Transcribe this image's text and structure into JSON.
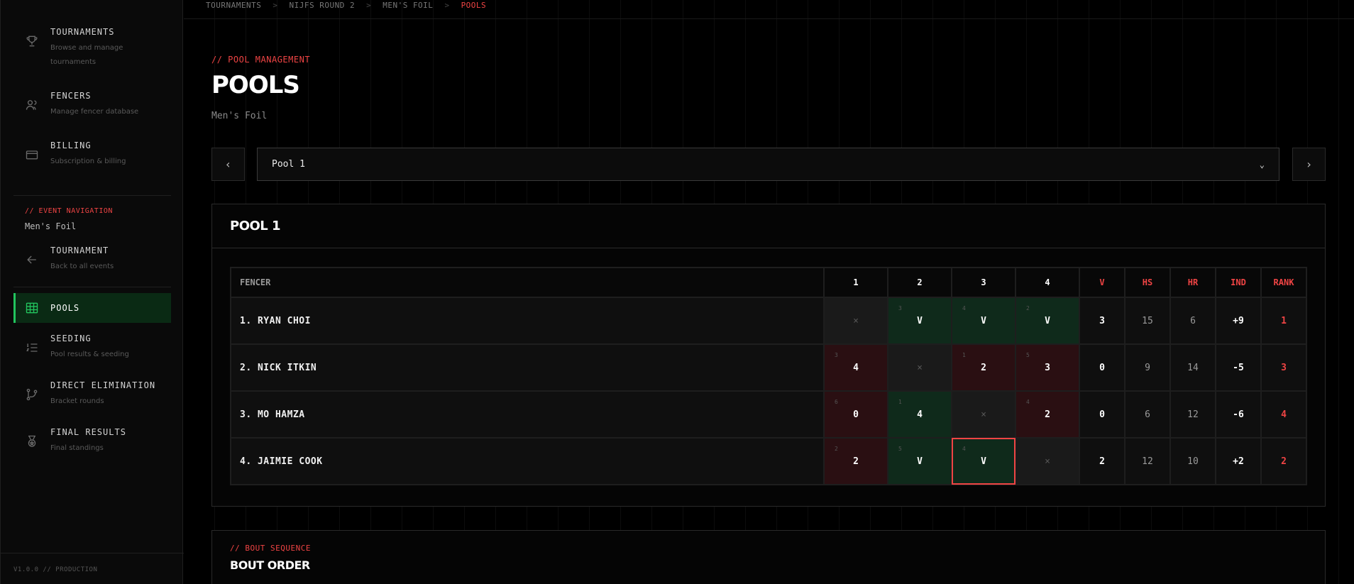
{
  "sidebar": {
    "items": [
      {
        "label": "TOURNAMENTS",
        "sub": "Browse and manage tournaments"
      },
      {
        "label": "FENCERS",
        "sub": "Manage fencer database"
      },
      {
        "label": "BILLING",
        "sub": "Subscription & billing"
      }
    ],
    "event_section": "// EVENT NAVIGATION",
    "event_name": "Men's Foil",
    "event_items": [
      {
        "label": "TOURNAMENT",
        "sub": "Back to all events"
      },
      {
        "label": "POOLS",
        "sub": ""
      },
      {
        "label": "SEEDING",
        "sub": "Pool results & seeding"
      },
      {
        "label": "DIRECT ELIMINATION",
        "sub": "Bracket rounds"
      },
      {
        "label": "FINAL RESULTS",
        "sub": "Final standings"
      }
    ],
    "version": "V1.0.0 // PRODUCTION"
  },
  "breadcrumb": [
    "TOURNAMENTS",
    "NIJFS ROUND 2",
    "MEN'S FOIL",
    "POOLS"
  ],
  "header": {
    "tag": "// POOL MANAGEMENT",
    "title": "POOLS",
    "subtitle": "Men's Foil"
  },
  "pool_select": {
    "value": "Pool 1"
  },
  "pool": {
    "title": "POOL 1",
    "headers": {
      "fencer": "FENCER",
      "cols": [
        "1",
        "2",
        "3",
        "4"
      ],
      "v": "V",
      "hs": "HS",
      "hr": "HR",
      "ind": "IND",
      "rank": "RANK"
    },
    "rows": [
      {
        "name": "1. RYAN CHOI",
        "bouts": [
          {
            "t": "self",
            "v": "×",
            "o": ""
          },
          {
            "t": "win",
            "v": "V",
            "o": "3"
          },
          {
            "t": "win",
            "v": "V",
            "o": "4"
          },
          {
            "t": "win",
            "v": "V",
            "o": "2"
          }
        ],
        "v": "3",
        "hs": "15",
        "hr": "6",
        "ind": "+9",
        "rank": "1"
      },
      {
        "name": "2. NICK ITKIN",
        "bouts": [
          {
            "t": "loss",
            "v": "4",
            "o": "3"
          },
          {
            "t": "self",
            "v": "×",
            "o": ""
          },
          {
            "t": "loss",
            "v": "2",
            "o": "1"
          },
          {
            "t": "loss",
            "v": "3",
            "o": "5"
          }
        ],
        "v": "0",
        "hs": "9",
        "hr": "14",
        "ind": "-5",
        "rank": "3"
      },
      {
        "name": "3. MO HAMZA",
        "bouts": [
          {
            "t": "loss",
            "v": "0",
            "o": "6"
          },
          {
            "t": "win",
            "v": "4",
            "o": "1"
          },
          {
            "t": "self",
            "v": "×",
            "o": ""
          },
          {
            "t": "loss",
            "v": "2",
            "o": "4"
          }
        ],
        "v": "0",
        "hs": "6",
        "hr": "12",
        "ind": "-6",
        "rank": "4"
      },
      {
        "name": "4. JAIMIE COOK",
        "bouts": [
          {
            "t": "loss",
            "v": "2",
            "o": "2"
          },
          {
            "t": "win",
            "v": "V",
            "o": "5"
          },
          {
            "t": "win sel",
            "v": "V",
            "o": "4"
          },
          {
            "t": "self",
            "v": "×",
            "o": ""
          }
        ],
        "v": "2",
        "hs": "12",
        "hr": "10",
        "ind": "+2",
        "rank": "2"
      }
    ]
  },
  "bout": {
    "tag": "// BOUT SEQUENCE",
    "title": "BOUT ORDER"
  },
  "colors": {
    "accent": "#ef4444",
    "active": "#22c55e",
    "win": "#0f2a1b",
    "loss": "#2a0f12"
  }
}
